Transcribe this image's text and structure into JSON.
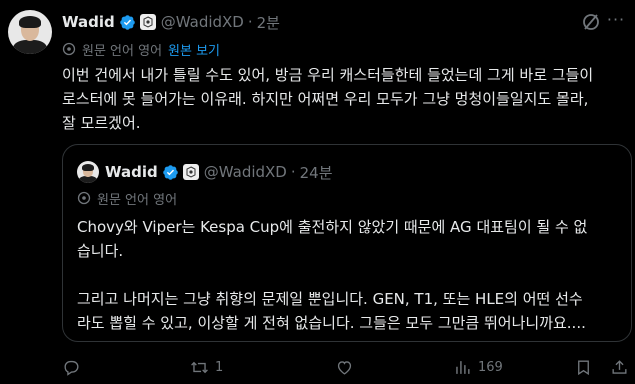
{
  "tweet": {
    "author_name": "Wadid",
    "handle": "@WadidXD",
    "separator": "·",
    "time": "2분",
    "translation_label": "원문 언어 영어",
    "show_original": "원본 보기",
    "lines": [
      "이번 건에서 내가 틀릴 수도 있어, 방금 우리 캐스터들한테 들었는데 그게 바로 그들이",
      "로스터에 못 들어가는 이유래. 하지만 어쩌면 우리 모두가 그냥 멍청이들일지도 몰라,",
      "잘 모르겠어."
    ]
  },
  "quote": {
    "author_name": "Wadid",
    "handle": "@WadidXD",
    "separator": "·",
    "time": "24분",
    "translation_label": "원문 언어 영어",
    "paragraph1_lines": [
      "Chovy와 Viper는 Kespa Cup에 출전하지 않았기 때문에 AG 대표팀이 될 수 없",
      "습니다."
    ],
    "paragraph2_lines": [
      "그리고 나머지는 그냥 취향의 문제일 뿐입니다. GEN, T1, 또는 HLE의 어떤 선수",
      "라도 뽑힐 수 있고, 이상할 게 전혀 없습니다. 그들은 모두 그만큼 뛰어나니까요...."
    ]
  },
  "actions": {
    "retweet_count": "1",
    "views_count": "169"
  },
  "icons": {
    "verified": "verified-badge-icon",
    "affiliate": "affiliate-badge-icon",
    "grok": "grok-icon",
    "more": "more-icon",
    "translate": "globe-icon",
    "reply": "reply-icon",
    "retweet": "retweet-icon",
    "like": "heart-icon",
    "views": "views-icon",
    "bookmark": "bookmark-icon",
    "share": "share-icon"
  },
  "colors": {
    "background": "#000000",
    "text": "#e7e9ea",
    "muted": "#71767b",
    "accent": "#1d9bf0",
    "border": "#2f3336"
  }
}
